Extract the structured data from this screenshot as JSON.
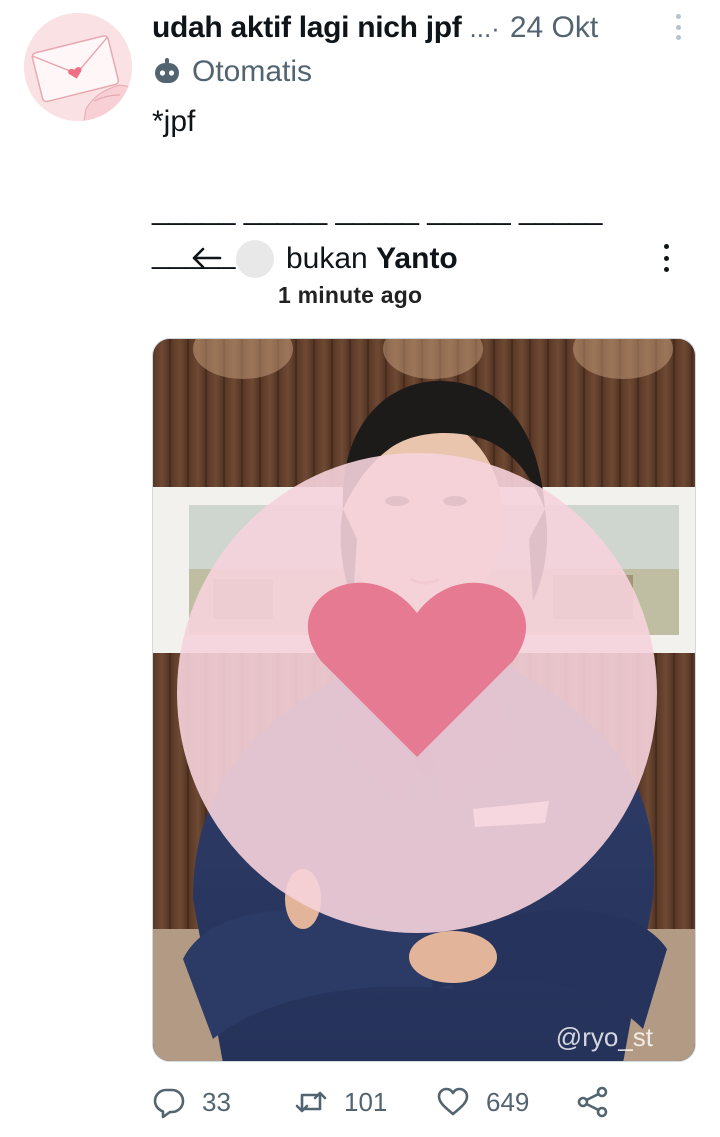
{
  "tweet": {
    "display_name": "udah aktif lagi nich jpf",
    "separator": "...·",
    "date": "24 Okt",
    "automated_label": "Otomatis",
    "text_lines": [
      "*jpf",
      "",
      "_____ _____ _____ _____ _____",
      "_____"
    ]
  },
  "quoted": {
    "name_prefix": "bukan ",
    "name_bold": "Yanto",
    "timestamp": "1 minute ago"
  },
  "media": {
    "watermark": "@ryo_st"
  },
  "actions": {
    "reply_count": "33",
    "retweet_count": "101",
    "like_count": "649"
  },
  "icons": {
    "reply": "reply-icon",
    "retweet": "retweet-icon",
    "like": "heart-icon",
    "share": "share-icon",
    "automated": "bot-icon",
    "back": "back-arrow-icon"
  },
  "colors": {
    "secondary_text": "#536471",
    "primary_text": "#0f1419"
  }
}
